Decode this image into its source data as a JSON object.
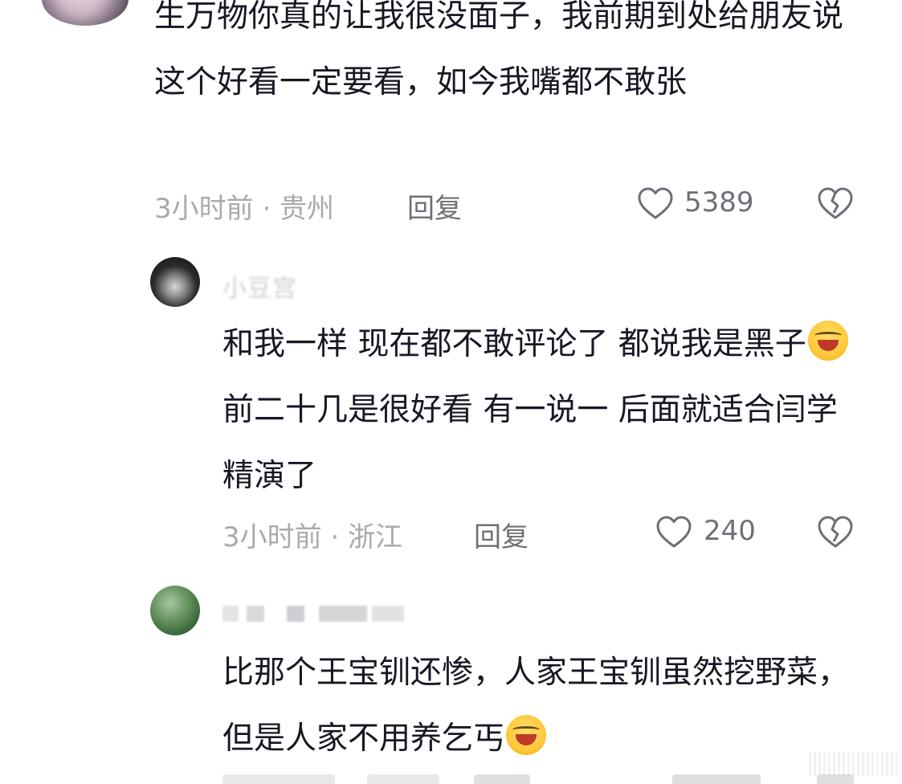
{
  "comments": [
    {
      "text": "生万物你真的让我很没面子，我前期到处给朋友说这个好看一定要看，如今我嘴都不敢张",
      "meta": "3小时前 · 贵州",
      "reply_label": "回复",
      "likes": "5389"
    },
    {
      "username": "小豆宫",
      "text_before_emoji": "和我一样 现在都不敢评论了  都说我是黑子",
      "emoji": "loudly-crying-face",
      "text_after_emoji": "前二十几是很好看 有一说一 后面就适合闫学精演了",
      "meta": "3小时前 · 浙江",
      "reply_label": "回复",
      "likes": "240"
    },
    {
      "username": "",
      "text_before_emoji": "比那个王宝钏还惨，人家王宝钏虽然挖野菜，但是人家不用养乞丐",
      "emoji": "loudly-crying-face"
    }
  ],
  "colors": {
    "text": "#161823",
    "meta": "#a9aab0",
    "action": "#6e7077",
    "username": "#cfcfd3"
  },
  "icons": {
    "like": "heart-outline-icon",
    "dislike": "broken-heart-icon"
  }
}
